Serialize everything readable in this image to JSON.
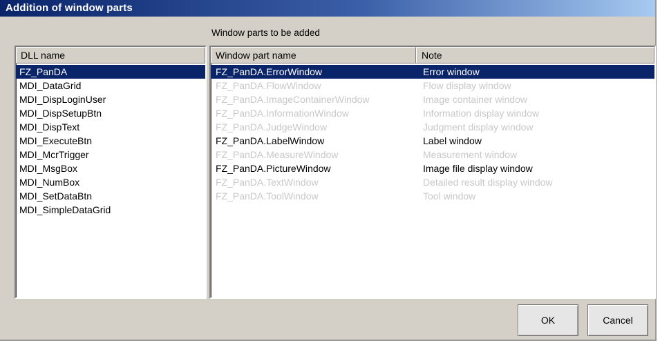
{
  "window": {
    "title": "Addition of window parts"
  },
  "section_caption": "Window parts to be added",
  "dll_list": {
    "header": "DLL name",
    "items": [
      {
        "label": "FZ_PanDA",
        "selected": true
      },
      {
        "label": "MDI_DataGrid",
        "selected": false
      },
      {
        "label": "MDI_DispLoginUser",
        "selected": false
      },
      {
        "label": "MDI_DispSetupBtn",
        "selected": false
      },
      {
        "label": "MDI_DispText",
        "selected": false
      },
      {
        "label": "MDI_ExecuteBtn",
        "selected": false
      },
      {
        "label": "MDI_McrTrigger",
        "selected": false
      },
      {
        "label": "MDI_MsgBox",
        "selected": false
      },
      {
        "label": "MDI_NumBox",
        "selected": false
      },
      {
        "label": "MDI_SetDataBtn",
        "selected": false
      },
      {
        "label": "MDI_SimpleDataGrid",
        "selected": false
      }
    ]
  },
  "parts_table": {
    "columns": [
      "Window part name",
      "Note"
    ],
    "rows": [
      {
        "name": "FZ_PanDA.ErrorWindow",
        "note": "Error window",
        "state": "selected"
      },
      {
        "name": "FZ_PanDA.FlowWindow",
        "note": "Flow display window",
        "state": "disabled"
      },
      {
        "name": "FZ_PanDA.ImageContainerWindow",
        "note": "Image container window",
        "state": "disabled"
      },
      {
        "name": "FZ_PanDA.InformationWindow",
        "note": "Information display window",
        "state": "disabled"
      },
      {
        "name": "FZ_PanDA.JudgeWindow",
        "note": "Judgment display window",
        "state": "disabled"
      },
      {
        "name": "FZ_PanDA.LabelWindow",
        "note": "Label window",
        "state": "enabled"
      },
      {
        "name": "FZ_PanDA.MeasureWindow",
        "note": "Measurement window",
        "state": "disabled"
      },
      {
        "name": "FZ_PanDA.PictureWindow",
        "note": "Image file display window",
        "state": "enabled"
      },
      {
        "name": "FZ_PanDA.TextWindow",
        "note": "Detailed result display window",
        "state": "disabled"
      },
      {
        "name": "FZ_PanDA.ToolWindow",
        "note": "Tool window",
        "state": "disabled"
      }
    ]
  },
  "buttons": {
    "ok": "OK",
    "cancel": "Cancel"
  },
  "colors": {
    "selection": "#0a246a",
    "disabled_text": "#c8c8c8",
    "dialog_bg": "#d4d0c8"
  }
}
